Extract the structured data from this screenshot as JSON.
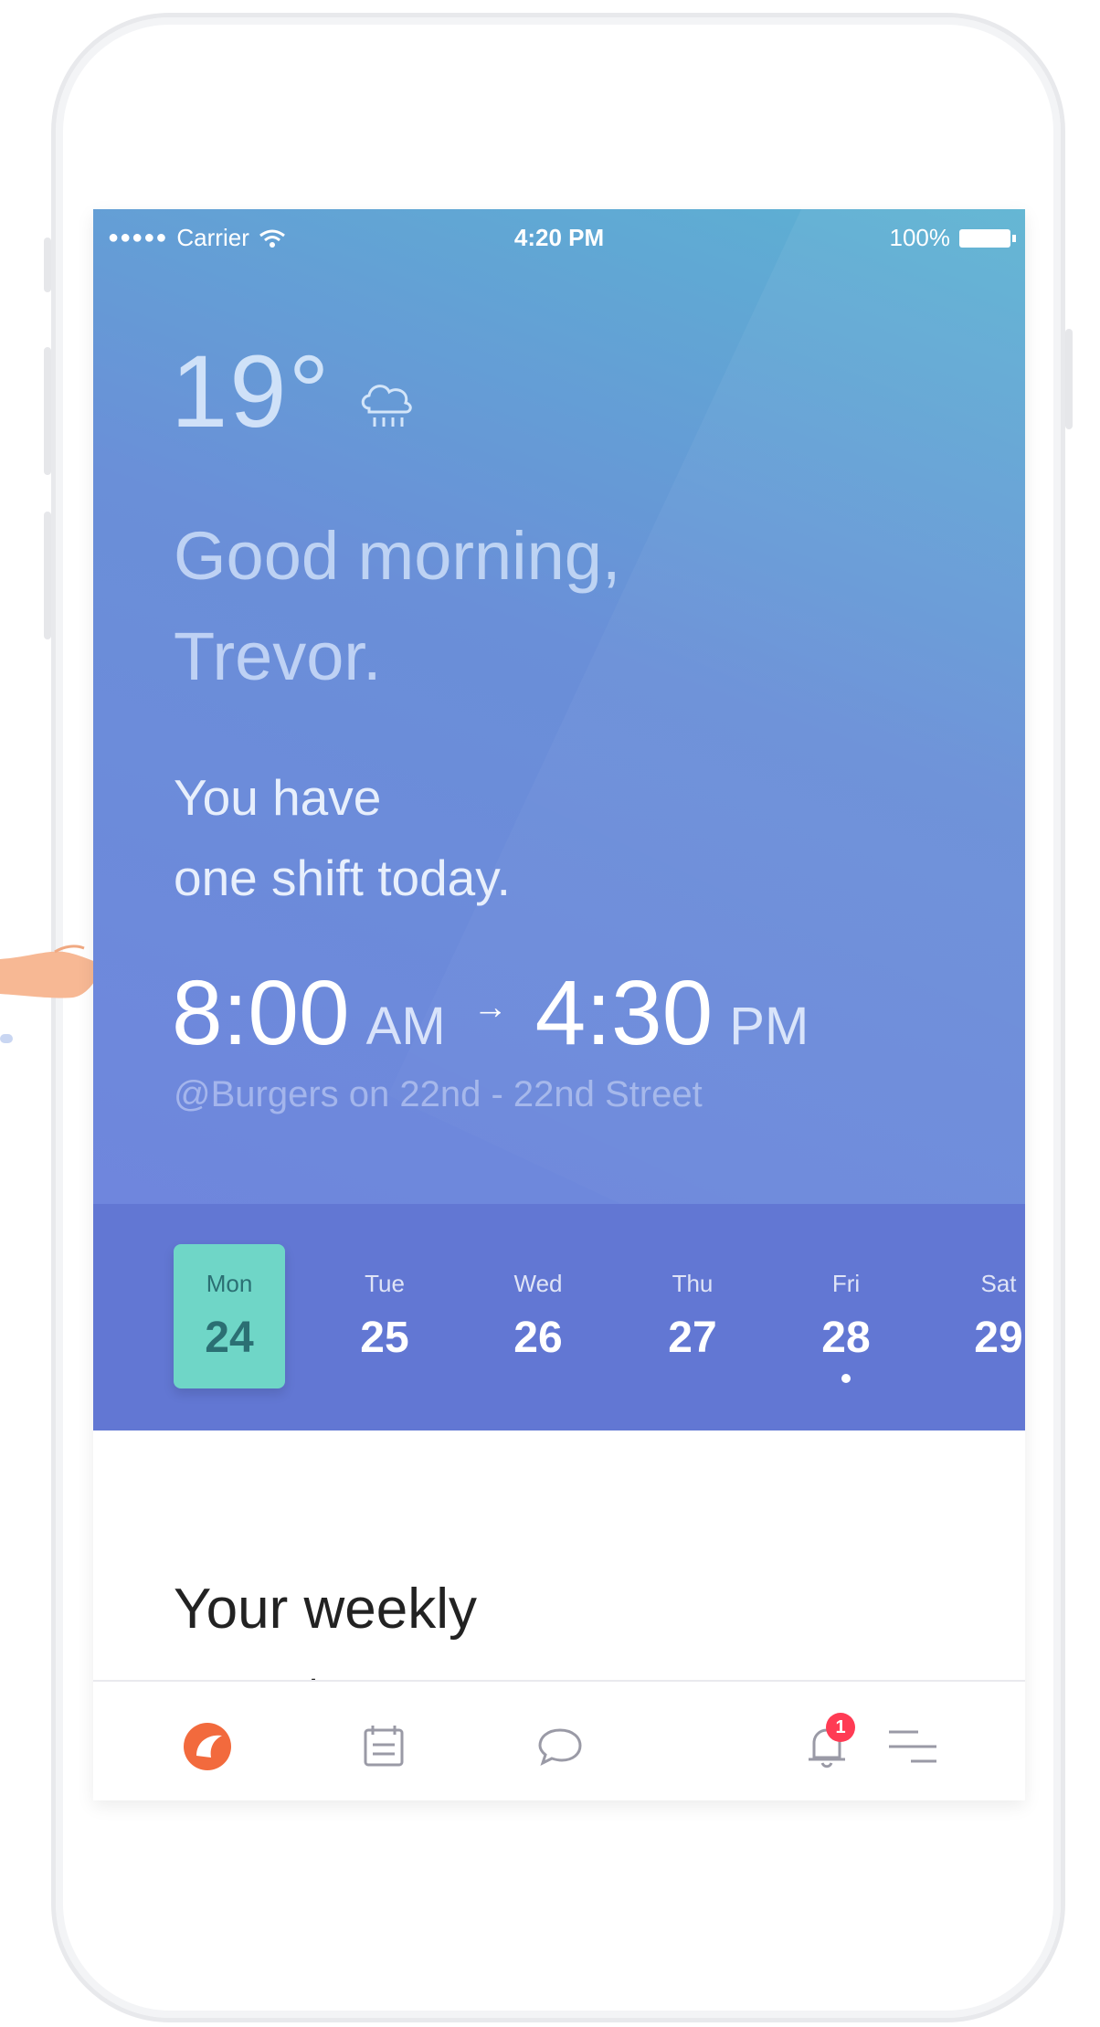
{
  "status_bar": {
    "signal": "●●●●●",
    "carrier": "Carrier",
    "time": "4:20 PM",
    "battery": "100%"
  },
  "weather": {
    "temperature": "19°",
    "icon": "cloud-rain-icon"
  },
  "greeting": {
    "line1": "Good morning,",
    "line2": "Trevor."
  },
  "shift_summary": {
    "line1": "You have",
    "line2": "one shift today."
  },
  "shift": {
    "start_time": "8:00",
    "start_period": "AM",
    "arrow": "→",
    "end_time": "4:30",
    "end_period": "PM",
    "location": "@Burgers on 22nd - 22nd Street"
  },
  "days": [
    {
      "name": "Mon",
      "date": "24",
      "selected": true
    },
    {
      "name": "Tue",
      "date": "25"
    },
    {
      "name": "Wed",
      "date": "26"
    },
    {
      "name": "Thu",
      "date": "27"
    },
    {
      "name": "Fri",
      "date": "28",
      "has_event": true
    },
    {
      "name": "Sat",
      "date": "29"
    }
  ],
  "weekly_report": {
    "title_line1": "Your weekly",
    "title_line2": "report"
  },
  "tab_bar": {
    "items": [
      "home-icon",
      "calendar-icon",
      "chat-icon",
      "bell-icon",
      "menu-icon"
    ],
    "notification_count": "1",
    "active_color": "#f26a3d"
  },
  "colors": {
    "hero_top": "#5cb3d2",
    "hero_bottom": "#6f86dd",
    "days_bg": "#6277d3",
    "selected_day": "#6fd6c7"
  }
}
